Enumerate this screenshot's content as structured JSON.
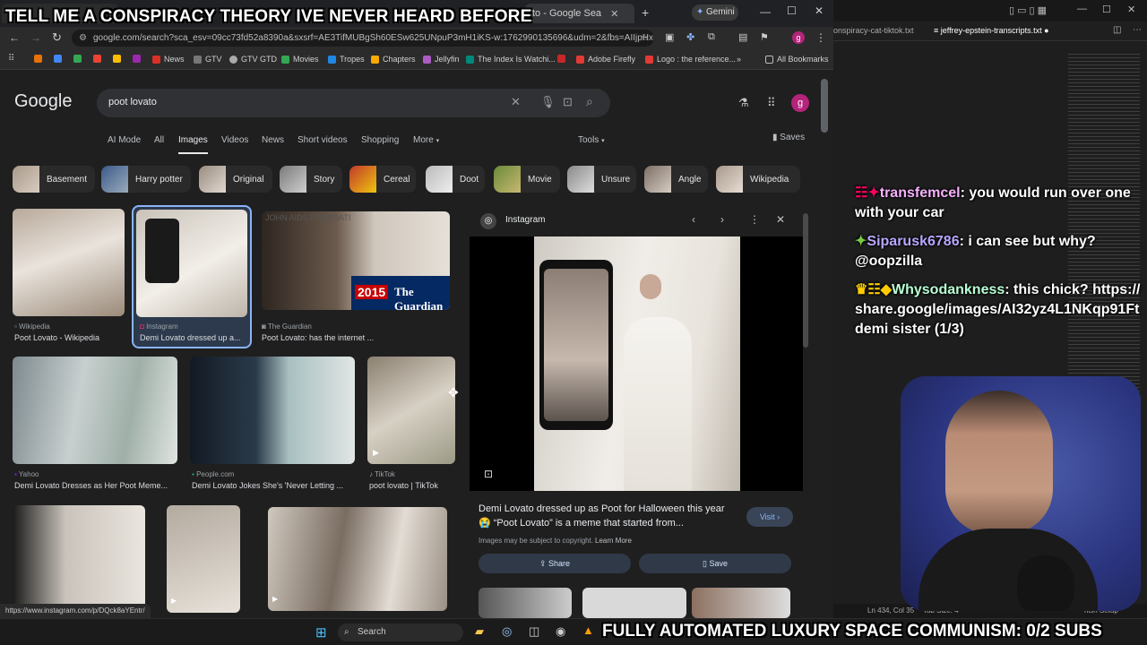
{
  "overlay": {
    "title": "TELL ME A CONSPIRACY THEORY IVE NEVER HEARD BEFORE",
    "subs": "FULLY AUTOMATED LUXURY SPACE COMMUNISM: 0/2 SUBS"
  },
  "browser": {
    "tab_active": "to - Google Sea",
    "gemini_label": "Gemini",
    "url": "google.com/search?sca_esv=09cc73fd52a8390a&sxsrf=AE3TifMUBgSh60ESw625UNpuP3mH1iKS-w:1762990135696&udm=2&fbs=AIIjpHxU7S...",
    "bookmarks": [
      "News",
      "GTV",
      "GTV GTD",
      "Movies",
      "Tropes",
      "Chapters",
      "Jellyfin",
      "The Index Is Watchi...",
      "Adobe Firefly",
      "Logo : the reference...",
      "All Bookmarks"
    ],
    "status_url": "https://www.instagram.com/p/DQck8aYEntr/"
  },
  "google": {
    "logo": "Google",
    "query": "poot lovato",
    "avatar_letter": "g",
    "nav_tabs": [
      "AI Mode",
      "All",
      "Images",
      "Videos",
      "News",
      "Short videos",
      "Shopping",
      "More"
    ],
    "tools_label": "Tools",
    "saves_label": "Saves",
    "chips": [
      "Basement",
      "Harry potter",
      "Original",
      "Story",
      "Cereal",
      "Doot",
      "Movie",
      "Unsure",
      "Angle",
      "Wikipedia"
    ],
    "results": [
      {
        "source": "Wikipedia",
        "caption": "Poot Lovato - Wikipedia"
      },
      {
        "source": "Instagram",
        "caption": "Demi Lovato dressed up a..."
      },
      {
        "source": "The Guardian",
        "caption": "Poot Lovato: has the internet ..."
      },
      {
        "source": "Yahoo",
        "caption": "Demi Lovato Dresses as Her Poot Meme..."
      },
      {
        "source": "People.com",
        "caption": "Demi Lovato Jokes She's 'Never Letting ..."
      },
      {
        "source": "TikTok",
        "caption": "poot lovato | TikTok"
      }
    ],
    "guardian_badge_year": "2015",
    "guardian_badge_name": "The Guardian",
    "foundation_text": "JOHN AIDS FOUNDATI",
    "preview": {
      "site": "Instagram",
      "title": "Demi Lovato dressed up as Poot for Halloween this year 😭 “Poot Lovato” is a meme that started from...",
      "visit_label": "Visit",
      "copyright": "Images may be subject to copyright.",
      "learn_more": "Learn More",
      "share_label": "Share",
      "save_label": "Save"
    }
  },
  "editor": {
    "tab1": "onspiracy-cat-tiktok.txt",
    "tab2": "jeffrey-epstein-transcripts.txt",
    "status_pos": "Ln 434, Col 35",
    "status_tab": "Tab Size: 4",
    "status_extra": "nish Setup"
  },
  "chat": [
    {
      "user": "transfemcel",
      "message": "you would run over one with your car",
      "color": "#f7b2ff"
    },
    {
      "user": "Siparusk6786",
      "message": "i can see but why? @oopzilla",
      "color": "#b9a7ff"
    },
    {
      "user": "Whysodankness",
      "message": "this chick? https://share.google/images/AI32yz4L1NKqp91Ft demi sister (1/3)",
      "color": "#b9ffd5"
    }
  ],
  "taskbar": {
    "search_label": "Search"
  }
}
